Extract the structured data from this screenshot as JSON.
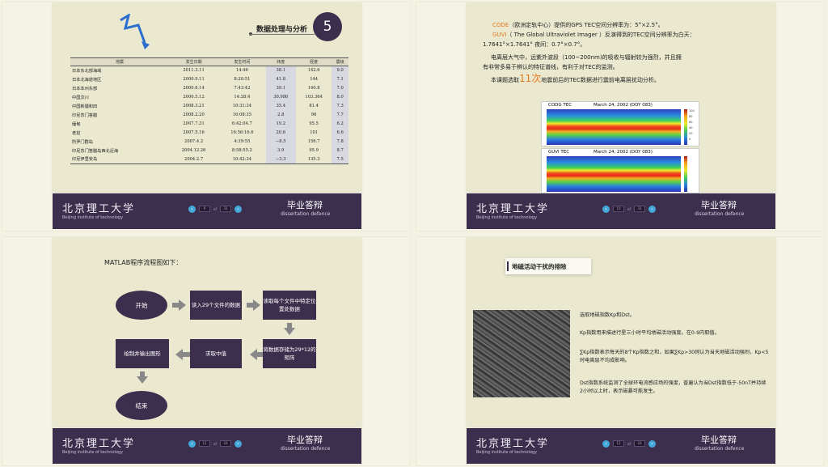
{
  "common": {
    "school_cn": "北京理工大学",
    "school_en": "Beijing institute of technology",
    "defence_cn": "毕业答辩",
    "defence_en": "dissertation defence",
    "pager_of": "of",
    "pager_total": "33",
    "prev_arrow": "‹",
    "next_arrow": "›",
    "accent": "#3c2f4e",
    "orange": "#e57a1c"
  },
  "slide1": {
    "section_title": "数据处理与分析",
    "section_number": "5",
    "page": "9",
    "columns": [
      "地震",
      "发生日期",
      "发生时间",
      "纬度",
      "经度",
      "震级"
    ],
    "rows": [
      [
        "日本东北部海域",
        "2011.3.11",
        "14:46",
        "38.1",
        "142.6",
        "9.0"
      ],
      [
        "日本北海道地区",
        "2000.9.11",
        "8:20:51",
        "41.8",
        "144",
        "7.1"
      ],
      [
        "日本本州东部",
        "2000.6.14",
        "7:43:42",
        "39.1",
        "140.8",
        "7.0"
      ],
      [
        "中国汶川",
        "2000.5.12",
        "14:28:4",
        "30.986",
        "103.364",
        "8.0"
      ],
      [
        "中国新疆和田",
        "2008.3.21",
        "10:31:34",
        "35.4",
        "81.4",
        "7.3"
      ],
      [
        "印尼苏门答腊",
        "2008.2.20",
        "16:08:35",
        "2.8",
        "96",
        "7.7"
      ],
      [
        "缅甸",
        "2007.7.31",
        "6:42:04.7",
        "19.2",
        "95.5",
        "6.2"
      ],
      [
        "老挝",
        "2007.5.16",
        "16:56:16.6",
        "20.6",
        "101",
        "6.6"
      ],
      [
        "所罗门群岛",
        "2007.4.2",
        "4:39:55",
        "−8.5",
        "156.7",
        "7.8"
      ],
      [
        "印尼苏门答腊岛西北近海",
        "2004.12.26",
        "8:58:55.2",
        "3.9",
        "95.9",
        "8.7"
      ],
      [
        "印尼伊里安岛",
        "2004.2.7",
        "10:42:34",
        "−3.3",
        "135.3",
        "7.5"
      ]
    ]
  },
  "slide2": {
    "page": "10",
    "line1_orange": "CODE",
    "line1_rest": "（欧洲定轨中心）提供的GPS TEC空间分辨率为：5°×2.5°。",
    "line2_orange": "GUVI",
    "line2_rest": "（ The Global Ultraviolet Imager ）反演得到的TEC空间分辨率为白天：",
    "line3": "1.7641°×1.7641° 夜间：0.7°×0.7°。",
    "line4": "电离层大气中，远紫外波段（100~200nm)的吸收与辐射较为强烈，并且拥",
    "line5": "有非常多易于辨认的特征谱线，有利于对TEC的监测。",
    "line6_a": "本课题选取",
    "line6_big": "11次",
    "line6_b": "地震前后的TEC数据进行震前电离层扰动分析。",
    "map1_label": "CODG TEC",
    "map1_date": "March 24, 2002 (DOY 083)",
    "map2_label": "GUVI TEC",
    "map2_date": "March 24, 2002 (DOY 083)",
    "colorbar_ticks": [
      "100",
      "80",
      "60",
      "40",
      "20",
      "0"
    ]
  },
  "slide3": {
    "page": "11",
    "heading": "MATLAB程序流程图如下：",
    "nodes": {
      "start": "开始",
      "read29": "读入29个文件的数据",
      "read_each": "读取每个文件中特定位置处数据",
      "store": "将数据存储为29*12的矩阵",
      "mean": "求取中值",
      "plot": "绘制并输出图形",
      "end": "结束"
    }
  },
  "slide4": {
    "page": "12",
    "heading": "地磁活动干扰的排除",
    "p1": "选取地磁指数Kp和Dst。",
    "p2": "Kp指数用来描述行星三小时平均地磁活动强度。在0-9内取值。",
    "p3": "∑Kp指数表示每天的8个Kp指数之和，如果∑Kp>30则认为当天地磁活动强烈，Kp<5时电离层不均成影响。",
    "p4": "Dst指数系统监测了全球环电流感应场的强度，普遍认为当Dst指数低于-50nT并持续2小时以上时，表示磁暴可能发生。"
  }
}
